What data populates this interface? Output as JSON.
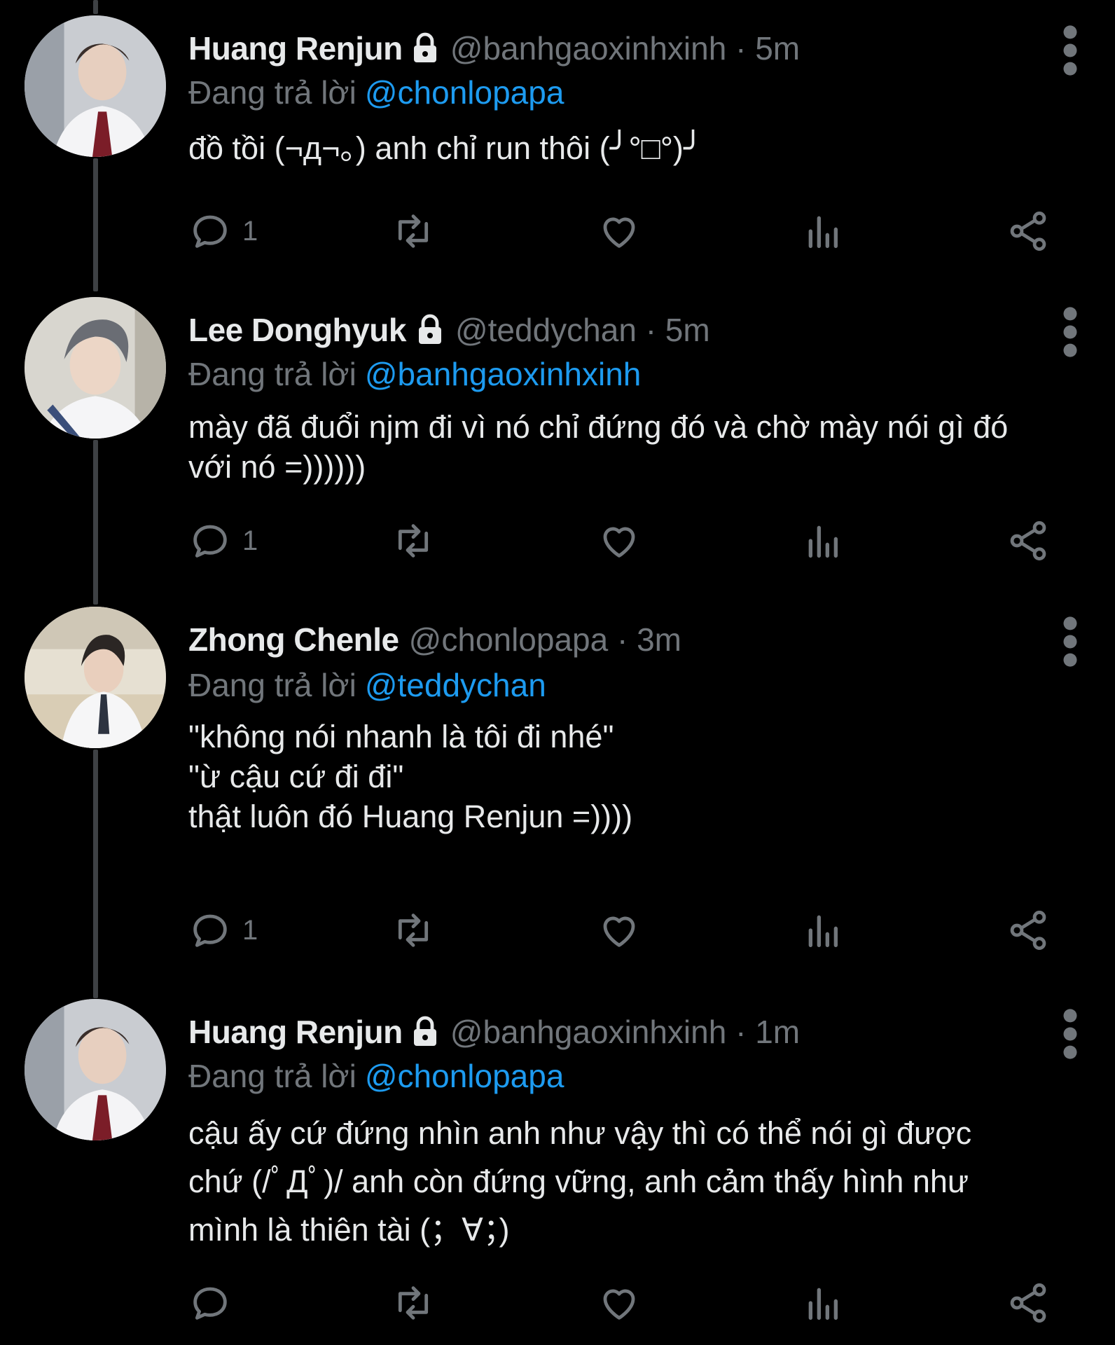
{
  "colors": {
    "background": "#000000",
    "text": "#e7e9ea",
    "muted": "#71767b",
    "link": "#1d9bf0",
    "thread_line": "#3e4144"
  },
  "tweets": [
    {
      "name": "Huang Renjun",
      "protected_icon": "lock-icon",
      "meta": "@banhgaoxinhxinh · 5m",
      "replying_label": "Đang trả lời",
      "replying_to": "@chonlopapa",
      "lines": [
        "đồ tồi (¬д¬。) anh chỉ run thôi (╯°□°)╯"
      ],
      "reply_count": "1"
    },
    {
      "name": "Lee Donghyuk",
      "protected_icon": "lock-icon",
      "meta": "@teddychan · 5m",
      "replying_label": "Đang trả lời",
      "replying_to": "@banhgaoxinhxinh",
      "lines": [
        "mày đã đuổi njm đi vì nó chỉ đứng đó và chờ mày nói gì đó",
        "với nó =))))))"
      ],
      "reply_count": "1"
    },
    {
      "name": "Zhong Chenle",
      "meta": "@chonlopapa · 3m",
      "replying_label": "Đang trả lời",
      "replying_to": "@teddychan",
      "lines": [
        "\"không nói nhanh là tôi đi nhé\"",
        "\"ừ cậu cứ đi đi\"",
        "thật luôn đó Huang Renjun =))))"
      ],
      "reply_count": "1"
    },
    {
      "name": "Huang Renjun",
      "protected_icon": "lock-icon",
      "meta": "@banhgaoxinhxinh · 1m",
      "replying_label": "Đang trả lời",
      "replying_to": "@chonlopapa",
      "lines": [
        "cậu ấy cứ đứng nhìn anh như vậy thì có thể nói gì được",
        "chứ (/ﾟДﾟ)/ anh còn đứng vững, anh cảm thấy hình như",
        "mình là thiên tài (；∀；)"
      ],
      "reply_count": ""
    }
  ],
  "action_icons": [
    "reply-icon",
    "retweet-icon",
    "like-icon",
    "views-icon",
    "share-icon"
  ]
}
